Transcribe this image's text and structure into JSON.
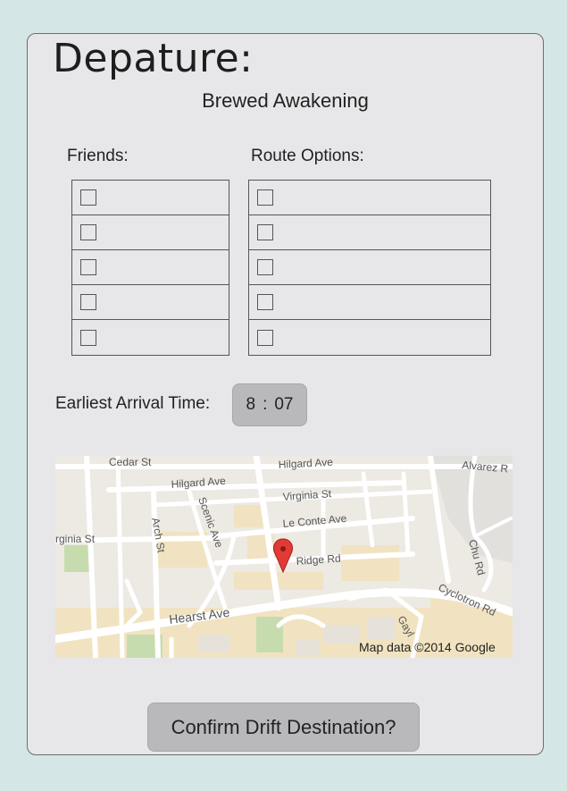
{
  "page": {
    "title": "Depature:",
    "destination": "Brewed Awakening"
  },
  "friends": {
    "label": "Friends:",
    "items": [
      "",
      "",
      "",
      "",
      ""
    ]
  },
  "routes": {
    "label": "Route Options:",
    "items": [
      "",
      "",
      "",
      "",
      ""
    ]
  },
  "arrival": {
    "label": "Earliest Arrival Time:",
    "hour": "8",
    "separator": ":",
    "minute": "07"
  },
  "map": {
    "streets": {
      "cedar": "Cedar St",
      "hilgard": "Hilgard Ave",
      "hilgard2": "Hilgard Ave",
      "virginia": "Virginia St",
      "virginia_left": "rginia St",
      "leconte": "Le Conte Ave",
      "ridge": "Ridge Rd",
      "hearst": "Hearst Ave",
      "arch": "Arch St",
      "scenic": "Scenic Ave",
      "alvarez": "Alvarez R",
      "chu": "Chu Rd",
      "cyclotron": "Cyclotron Rd",
      "gayley": "Gayl"
    },
    "attribution": "Map data ©2014 Google",
    "pin_icon": "map-pin-icon",
    "colors": {
      "base": "#ede9e3",
      "campus": "#f1e3c1",
      "park": "#c7dcae",
      "road": "#ffffff",
      "pin": "#e23b35"
    }
  },
  "actions": {
    "confirm_label": "Confirm Drift Destination?"
  }
}
